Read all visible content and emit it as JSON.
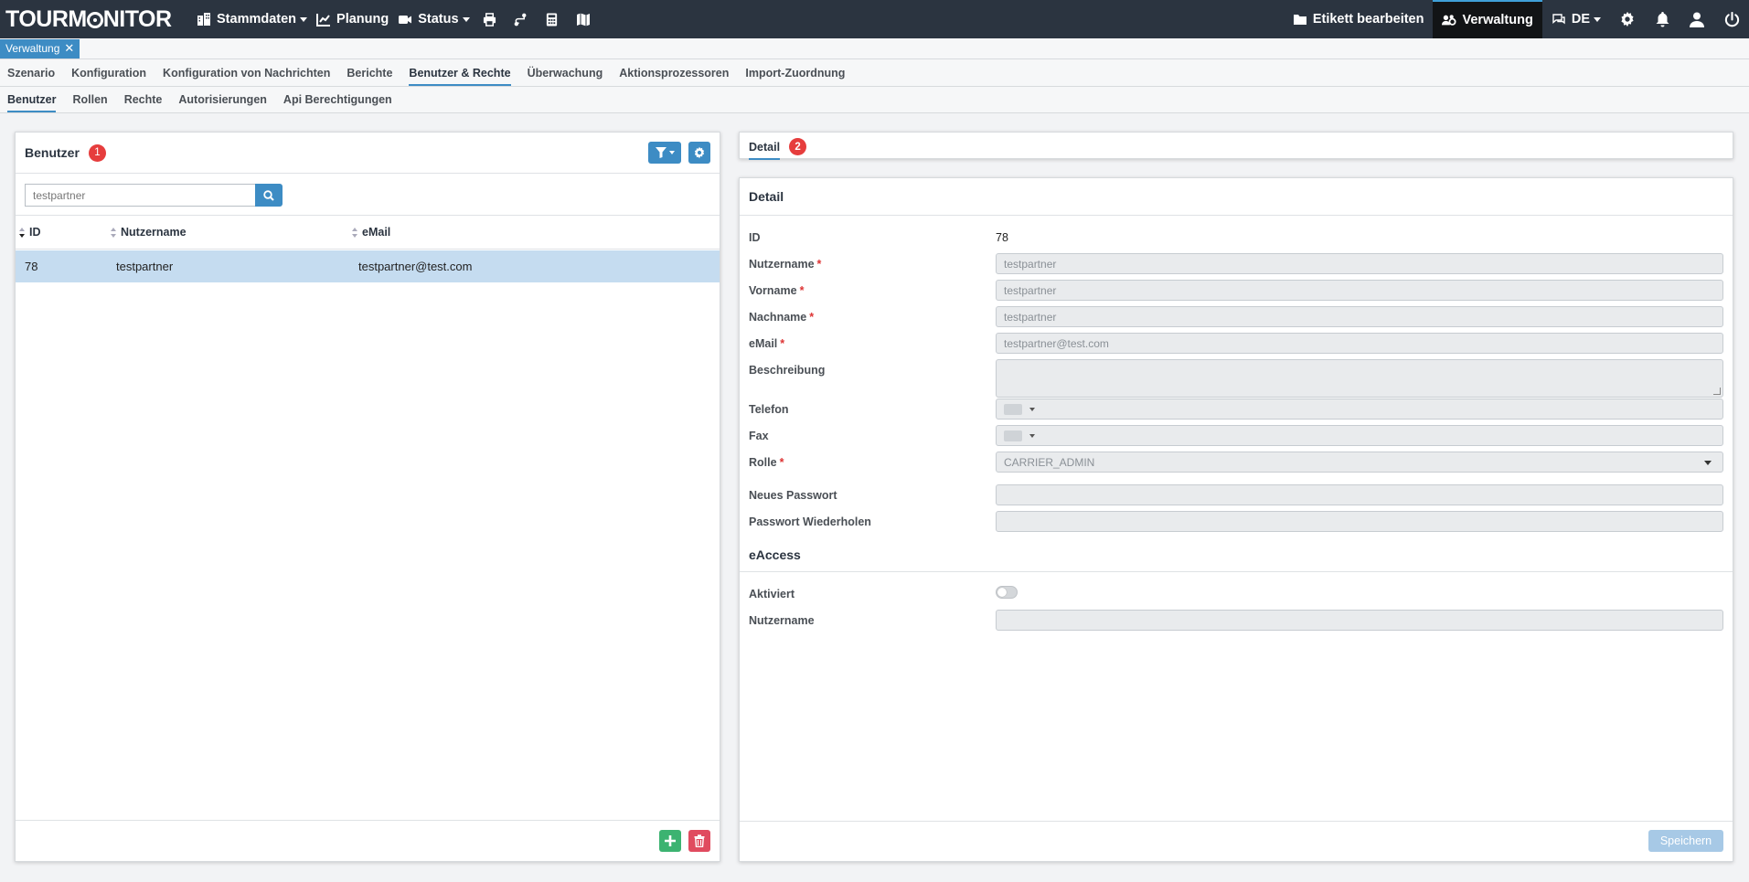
{
  "header": {
    "logo": "TOURMONITOR",
    "nav": [
      {
        "label": "Stammdaten",
        "icon": "building-icon",
        "dropdown": true
      },
      {
        "label": "Planung",
        "icon": "chart-icon",
        "dropdown": false
      },
      {
        "label": "Status",
        "icon": "video-icon",
        "dropdown": true
      }
    ],
    "right": {
      "edit_label": "Etikett bearbeiten",
      "admin_label": "Verwaltung",
      "language": "DE"
    }
  },
  "open_tab": {
    "label": "Verwaltung"
  },
  "menu1": [
    "Szenario",
    "Konfiguration",
    "Konfiguration von Nachrichten",
    "Berichte",
    "Benutzer & Rechte",
    "Überwachung",
    "Aktionsprozessoren",
    "Import-Zuordnung"
  ],
  "menu1_active": "Benutzer & Rechte",
  "menu2": [
    "Benutzer",
    "Rollen",
    "Rechte",
    "Autorisierungen",
    "Api Berechtigungen"
  ],
  "menu2_active": "Benutzer",
  "users_panel": {
    "title": "Benutzer",
    "badge": "1",
    "search_value": "testpartner",
    "columns": [
      "ID",
      "Nutzername",
      "eMail"
    ],
    "rows": [
      {
        "id": "78",
        "username": "testpartner",
        "email": "testpartner@test.com"
      }
    ]
  },
  "detail_tabs": {
    "label": "Detail",
    "badge": "2"
  },
  "detail": {
    "title": "Detail",
    "fields": {
      "id_label": "ID",
      "id_value": "78",
      "username_label": "Nutzername",
      "username_value": "testpartner",
      "firstname_label": "Vorname",
      "firstname_value": "testpartner",
      "lastname_label": "Nachname",
      "lastname_value": "testpartner",
      "email_label": "eMail",
      "email_value": "testpartner@test.com",
      "description_label": "Beschreibung",
      "description_value": "",
      "phone_label": "Telefon",
      "fax_label": "Fax",
      "role_label": "Rolle",
      "role_value": "CARRIER_ADMIN",
      "new_password_label": "Neues Passwort",
      "repeat_password_label": "Passwort Wiederholen"
    },
    "eaccess": {
      "title": "eAccess",
      "activated_label": "Aktiviert",
      "activated": false,
      "username_label": "Nutzername",
      "username_value": ""
    },
    "save_label": "Speichern"
  },
  "colors": {
    "accent": "#3d8cc4",
    "navbar": "#2b3440",
    "badge": "#e63d3d",
    "add": "#3cb371",
    "delete": "#e04b5f"
  }
}
